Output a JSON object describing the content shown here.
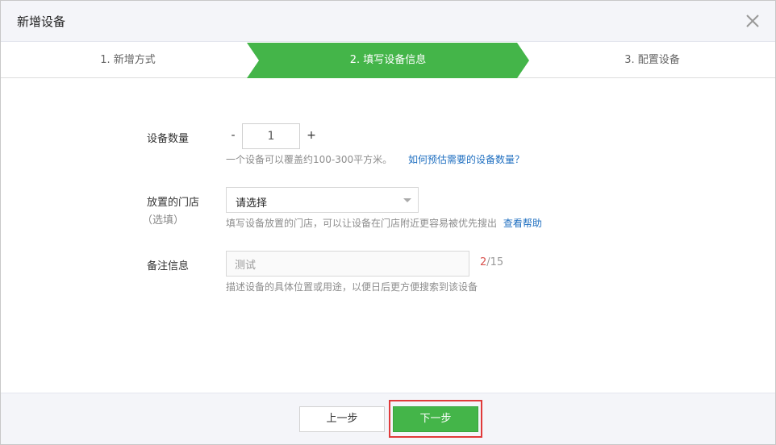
{
  "dialog": {
    "title": "新增设备",
    "close_icon": "close-icon"
  },
  "steps": [
    {
      "label": "1. 新增方式"
    },
    {
      "label": "2. 填写设备信息"
    },
    {
      "label": "3. 配置设备"
    }
  ],
  "colors": {
    "accent": "#44b549",
    "link": "#1f6fc0",
    "error": "#d9534f",
    "highlight_border": "#e03a3a"
  },
  "form": {
    "quantity": {
      "label": "设备数量",
      "minus": "-",
      "plus": "+",
      "value": "1",
      "hint": "一个设备可以覆盖约100-300平方米。",
      "link": "如何预估需要的设备数量？"
    },
    "store": {
      "label": "放置的门店",
      "sublabel": "（选填）",
      "selected": "请选择",
      "hint": "填写设备放置的门店，可以让设备在门店附近更容易被优先搜出",
      "link": "查看帮助"
    },
    "note": {
      "label": "备注信息",
      "value": "测试",
      "count_current": "2",
      "count_max": "/15",
      "hint": "描述设备的具体位置或用途，以便日后更方便搜索到该设备"
    }
  },
  "footer": {
    "prev_label": "上一步",
    "next_label": "下一步"
  }
}
